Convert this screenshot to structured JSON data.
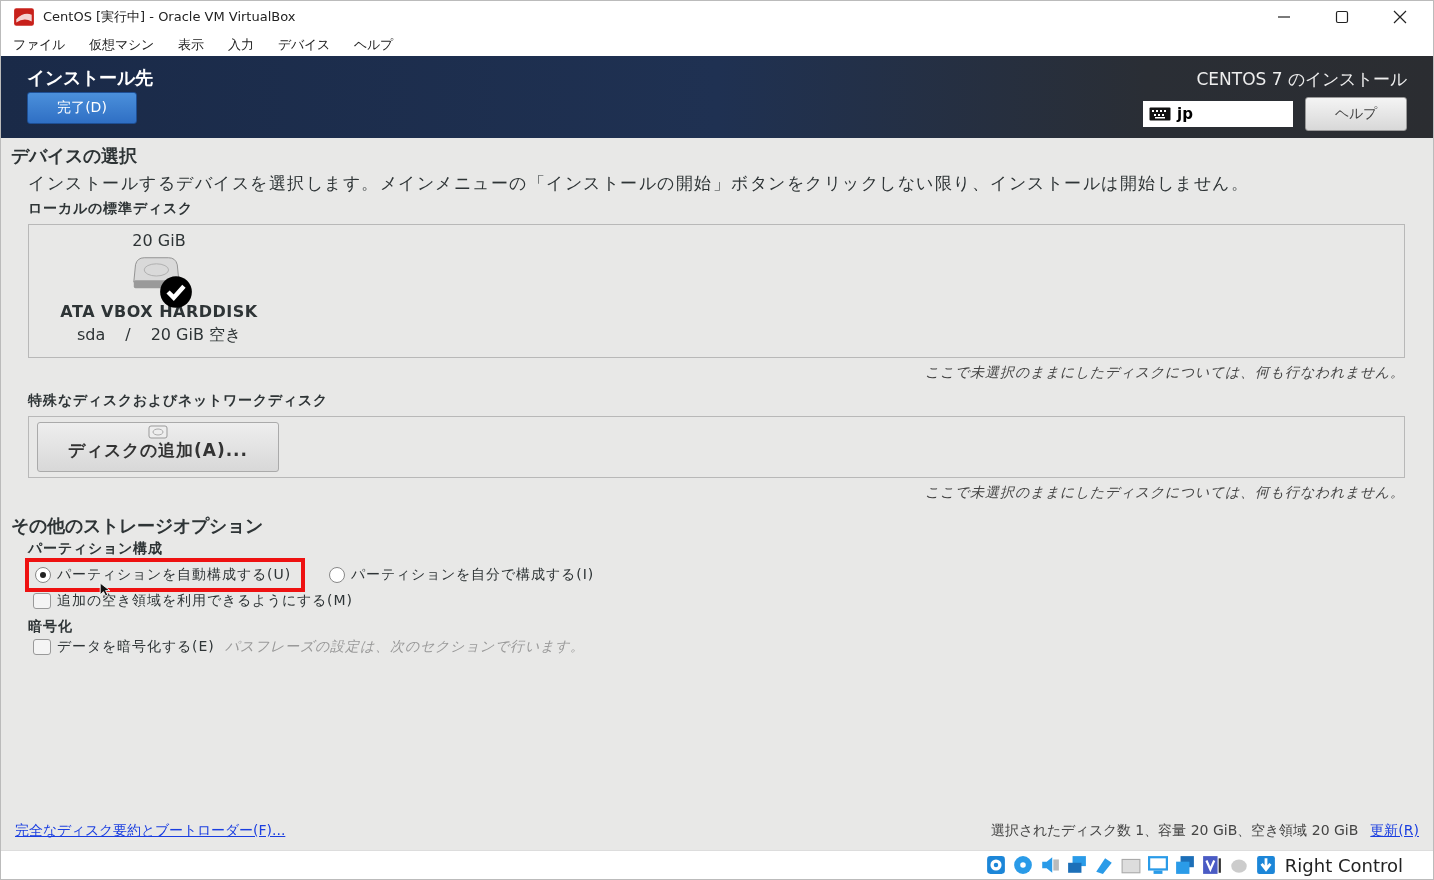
{
  "window": {
    "title": "CentOS [実行中] - Oracle VM VirtualBox"
  },
  "menu": [
    "ファイル",
    "仮想マシン",
    "表示",
    "入力",
    "デバイス",
    "ヘルプ"
  ],
  "header": {
    "title": "インストール先",
    "done_button": "完了(D)",
    "product": "CENTOS 7 のインストール",
    "keyboard_layout": "jp",
    "help_button": "ヘルプ"
  },
  "device_selection": {
    "heading": "デバイスの選択",
    "description": "インストールするデバイスを選択します。メインメニューの「インストールの開始」ボタンをクリックしない限り、インストールは開始しません。",
    "local_disks": {
      "label": "ローカルの標準ディスク",
      "disks": [
        {
          "size": "20 GiB",
          "name": "ATA VBOX HARDDISK",
          "device": "sda",
          "separator": "/",
          "free": "20 GiB 空き",
          "selected": true
        }
      ],
      "note": "ここで未選択のままにしたディスクについては、何も行なわれません。"
    },
    "special_disks": {
      "label": "特殊なディスクおよびネットワークディスク",
      "add_button": "ディスクの追加(A)...",
      "note": "ここで未選択のままにしたディスクについては、何も行なわれません。"
    }
  },
  "storage_options": {
    "heading": "その他のストレージオプション",
    "partitioning": {
      "label": "パーティション構成",
      "options": [
        {
          "label": "パーティションを自動構成する(U)",
          "selected": true,
          "highlighted": true
        },
        {
          "label": "パーティションを自分で構成する(I)",
          "selected": false,
          "highlighted": false
        }
      ],
      "extra_space": {
        "label": "追加の空き領域を利用できるようにする(M)",
        "checked": false
      }
    },
    "encryption": {
      "label": "暗号化",
      "checkbox": {
        "label": "データを暗号化する(E)",
        "checked": false
      },
      "hint": "パスフレーズの設定は、次のセクションで行います。"
    }
  },
  "footer": {
    "summary_link": "完全なディスク要約とブートローダー(F)...",
    "summary": "選択されたディスク数 1、容量 20 GiB、空き領域 20 GiB",
    "refresh_link": "更新(R)"
  },
  "status_bar": {
    "host_key": "Right Control"
  }
}
